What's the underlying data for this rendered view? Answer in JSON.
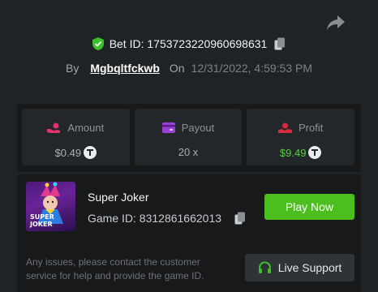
{
  "header": {
    "bet_id_label": "Bet ID: 1753723220960698631",
    "by_label": "By",
    "username": "Mgbqltfckwb",
    "on_label": "On",
    "date": "12/31/2022, 4:59:53 PM"
  },
  "stats": [
    {
      "label": "Amount",
      "value": "$0.49",
      "icon": "coins-hand-icon"
    },
    {
      "label": "Payout",
      "value": "20 x",
      "icon": "wallet-icon"
    },
    {
      "label": "Profit",
      "value": "$9.49",
      "icon": "profit-hand-icon"
    }
  ],
  "game": {
    "title": "Super Joker",
    "id_label": "Game ID: 8312861662013",
    "thumb_text_1": "SUPER",
    "thumb_text_2": "JOKER",
    "play_label": "Play Now",
    "help_text": "Any issues, please contact the customer service for help and provide the game ID.",
    "support_label": "Live Support"
  },
  "colors": {
    "accent_green": "#4cbf1f",
    "profit_green": "#52d23b",
    "icon_pink": "#e2336b",
    "icon_purple": "#9b3fd9",
    "icon_red": "#d92b3a"
  }
}
